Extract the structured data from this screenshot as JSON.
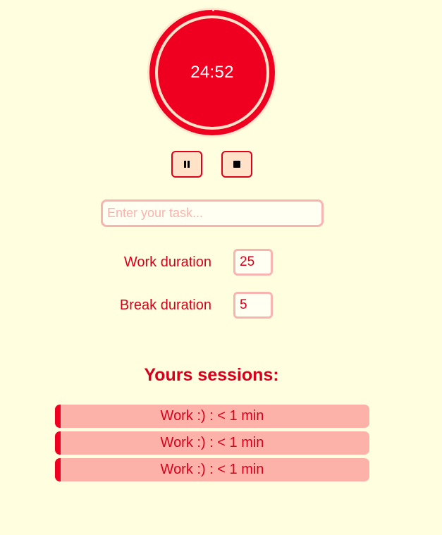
{
  "timer": {
    "display": "24:52",
    "progress_fraction": 0.005,
    "colors": {
      "fill": "#f00020",
      "ring": "#ffe2c8",
      "halo": "#fde6cc"
    }
  },
  "controls": {
    "pause_icon": "pause-icon",
    "stop_icon": "stop-icon"
  },
  "task": {
    "value": "",
    "placeholder": "Enter your task..."
  },
  "settings": {
    "work_label": "Work duration",
    "work_value": "25",
    "break_label": "Break duration",
    "break_value": "5"
  },
  "sessions": {
    "title": "Yours sessions:",
    "items": [
      {
        "label": "Work :) : < 1 min"
      },
      {
        "label": "Work :) : < 1 min"
      },
      {
        "label": "Work :) : < 1 min"
      }
    ]
  },
  "colors": {
    "background": "#ffffe0",
    "accent": "#e0001a",
    "session_bg": "#fcb2a8",
    "input_border": "#f8b4b0"
  }
}
